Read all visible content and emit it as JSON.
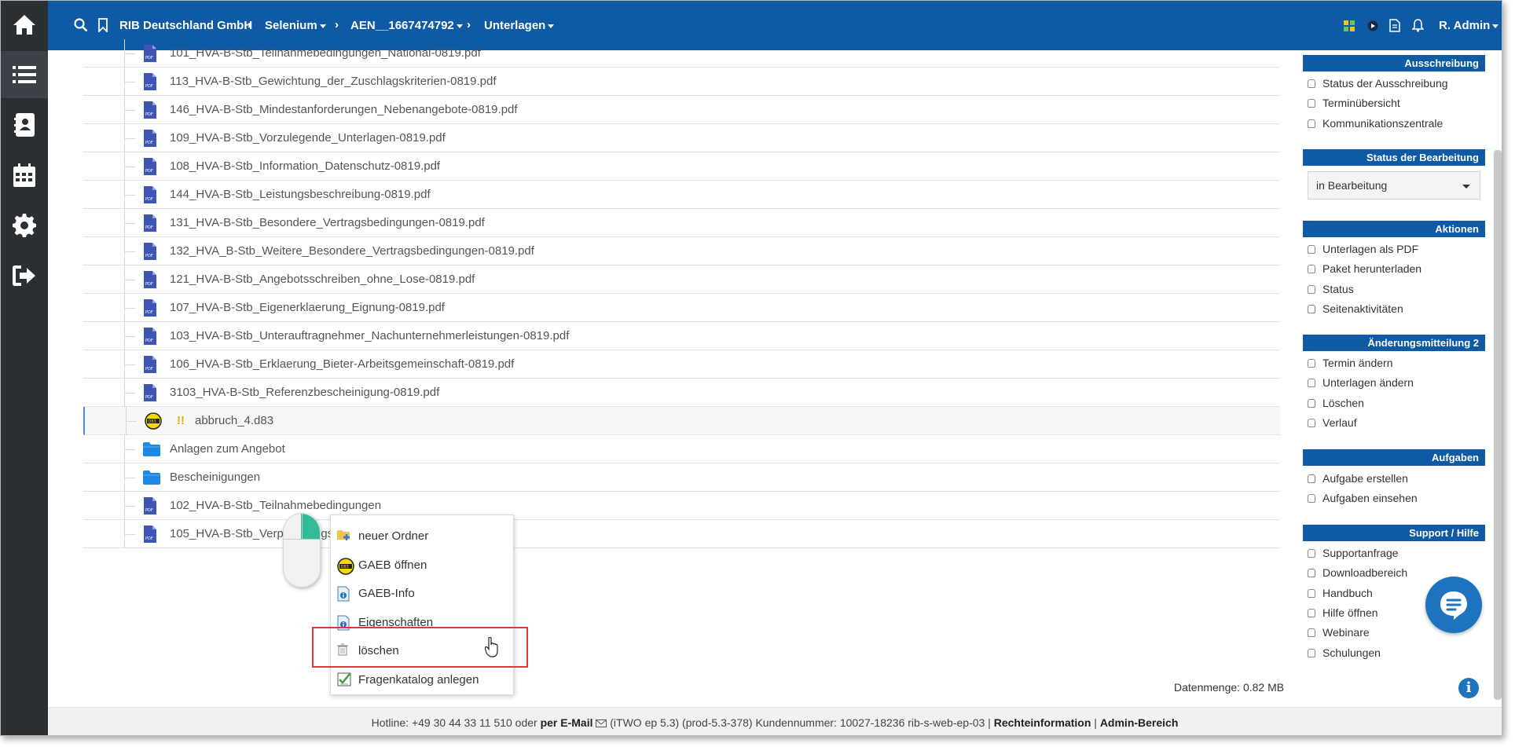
{
  "topbar": {
    "company": "RIB Deutschland GmbH",
    "crumb1": "Selenium",
    "crumb2": "AEN__1667474792",
    "crumb3": "Unterlagen",
    "user": "R. Admin"
  },
  "files": [
    {
      "name": "101_HVA-B-Stb_Teilnahmebedingungen_National-0819.pdf",
      "icon": "pdf-icon"
    },
    {
      "name": "113_HVA-B-Stb_Gewichtung_der_Zuschlagskriterien-0819.pdf",
      "icon": "pdf-icon"
    },
    {
      "name": "146_HVA-B-Stb_Mindestanforderungen_Nebenangebote-0819.pdf",
      "icon": "pdf-icon"
    },
    {
      "name": "109_HVA-B-Stb_Vorzulegende_Unterlagen-0819.pdf",
      "icon": "pdf-icon"
    },
    {
      "name": "108_HVA-B-Stb_Information_Datenschutz-0819.pdf",
      "icon": "pdf-icon"
    },
    {
      "name": "144_HVA-B-Stb_Leistungsbeschreibung-0819.pdf",
      "icon": "pdf-icon"
    },
    {
      "name": "131_HVA-B-Stb_Besondere_Vertragsbedingungen-0819.pdf",
      "icon": "pdf-icon"
    },
    {
      "name": "132_HVA_B-Stb_Weitere_Besondere_Vertragsbedingungen-0819.pdf",
      "icon": "pdf-icon"
    },
    {
      "name": "121_HVA-B-Stb_Angebotsschreiben_ohne_Lose-0819.pdf",
      "icon": "pdf-icon"
    },
    {
      "name": "107_HVA-B-Stb_Eigenerklaerung_Eignung-0819.pdf",
      "icon": "pdf-icon"
    },
    {
      "name": "103_HVA-B-Stb_Unterauftragnehmer_Nachunternehmerleistungen-0819.pdf",
      "icon": "pdf-icon"
    },
    {
      "name": "106_HVA-B-Stb_Erklaerung_Bieter-Arbeitsgemeinschaft-0819.pdf",
      "icon": "pdf-icon"
    },
    {
      "name": "3103_HVA-B-Stb_Referenzbescheinigung-0819.pdf",
      "icon": "pdf-icon"
    },
    {
      "name": "abbruch_4.d83",
      "icon": "gaeb-icon",
      "warning": "!!"
    },
    {
      "name": "Anlagen zum Angebot",
      "icon": "folder-icon"
    },
    {
      "name": "Bescheinigungen",
      "icon": "folder-icon"
    },
    {
      "name": "102_HVA-B-Stb_Teilnahmebedingungen",
      "icon": "pdf-icon"
    },
    {
      "name": "105_HVA-B-Stb_Verpflichtungserklaerung",
      "icon": "pdf-icon"
    }
  ],
  "context_menu": [
    {
      "label": "neuer Ordner",
      "icon": "new-folder-icon"
    },
    {
      "label": "GAEB öffnen",
      "icon": "gaeb-icon"
    },
    {
      "label": "GAEB-Info",
      "icon": "info-doc-icon"
    },
    {
      "label": "Eigenschaften",
      "icon": "info-doc-icon"
    },
    {
      "label": "löschen",
      "icon": "trash-icon"
    },
    {
      "label": "Fragenkatalog anlegen",
      "icon": "checklist-icon"
    }
  ],
  "sidebar": {
    "ausschreibung": {
      "title": "Ausschreibung",
      "items": [
        "Status der Ausschreibung",
        "Terminübersicht",
        "Kommunikationszentrale"
      ]
    },
    "status": {
      "title": "Status der Bearbeitung",
      "value": "in Bearbeitung"
    },
    "aktionen": {
      "title": "Aktionen",
      "items": [
        "Unterlagen als PDF",
        "Paket herunterladen",
        "Status",
        "Seitenaktivitäten"
      ]
    },
    "aenderung": {
      "title": "Änderungsmitteilung 2",
      "items": [
        "Termin ändern",
        "Unterlagen ändern",
        "Löschen",
        "Verlauf"
      ]
    },
    "aufgaben": {
      "title": "Aufgaben",
      "items": [
        "Aufgabe erstellen",
        "Aufgaben einsehen"
      ]
    },
    "support": {
      "title": "Support / Hilfe",
      "items": [
        "Supportanfrage",
        "Downloadbereich",
        "Handbuch",
        "Hilfe öffnen",
        "Webinare",
        "Schulungen"
      ]
    }
  },
  "datenmenge": "Datenmenge: 0.82 MB",
  "footer": {
    "hotline": "Hotline: +49 30 44 33 11 510 oder",
    "email": "per E-Mail",
    "version": "(iTWO ep 5.3)  (prod-5.3-378)   Kundennummer: 10027-18236 rib-s-web-ep-03 |",
    "recht": "Rechteinformation",
    "pipe": "|",
    "admin": "Admin-Bereich"
  },
  "colors": {
    "brand": "#0f5aa5",
    "nav": "#2a2f33",
    "highlight": "#e0373a",
    "pdf": "#3d55b5"
  }
}
